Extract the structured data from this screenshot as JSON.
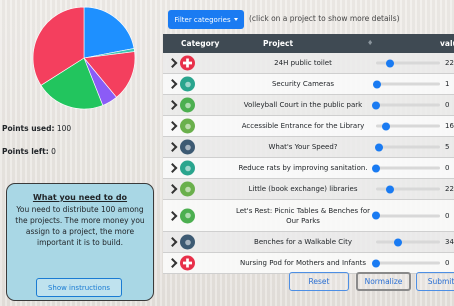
{
  "stats": {
    "points_used_label": "Points used:",
    "points_used_value": "100",
    "points_left_label": "Points left:",
    "points_left_value": "0"
  },
  "info": {
    "title": "What you need to do",
    "text": "You need to distribute 100 among the projects. The more money you assign to a project, the more important it is to build.",
    "button": "Show instructions"
  },
  "toolbar": {
    "filter_label": "Filter categories",
    "hint": "(click on a project to show more details)"
  },
  "table": {
    "headers": {
      "category": "Category",
      "project": "Project",
      "sort": "♦",
      "value": "valu"
    },
    "rows": [
      {
        "category_icon": "health-cross-icon",
        "icon_color": "#e8304a",
        "project": "24H public toilet",
        "value": "22",
        "level": 0.22
      },
      {
        "category_icon": "camera-icon",
        "icon_color": "#2aa58e",
        "project": "Security Cameras",
        "value": "1",
        "level": 0.01
      },
      {
        "category_icon": "park-icon",
        "icon_color": "#4caf50",
        "project": "Volleyball Court in the public park",
        "value": "0",
        "level": 0.0
      },
      {
        "category_icon": "culture-icon",
        "icon_color": "#6ab04c",
        "project": "Accessible Entrance for the Library",
        "value": "16",
        "level": 0.16
      },
      {
        "category_icon": "road-icon",
        "icon_color": "#3d5a73",
        "project": "What's Your Speed?",
        "value": "5",
        "level": 0.05
      },
      {
        "category_icon": "environment-icon",
        "icon_color": "#2aa58e",
        "project": "Reduce rats by improving sanitation.",
        "value": "0",
        "level": 0.0
      },
      {
        "category_icon": "culture-icon",
        "icon_color": "#6ab04c",
        "project": "Little (book exchange) libraries",
        "value": "22",
        "level": 0.22
      },
      {
        "category_icon": "park-icon",
        "icon_color": "#4caf50",
        "project": "Let's Rest: Picnic Tables & Benches for Our Parks",
        "value": "0",
        "level": 0.0
      },
      {
        "category_icon": "road-icon",
        "icon_color": "#3d5a73",
        "project": "Benches for a Walkable City",
        "value": "34",
        "level": 0.34
      },
      {
        "category_icon": "health-cross-icon",
        "icon_color": "#e8304a",
        "project": "Nursing Pod for Mothers and Infants",
        "value": "0",
        "level": 0.0
      }
    ]
  },
  "buttons": {
    "reset": "Reset",
    "normalize": "Normalize",
    "submit": "Submit"
  },
  "pie_slices": [
    {
      "value": 22,
      "color": "#1e90ff"
    },
    {
      "value": 1,
      "color": "#3cc8b4"
    },
    {
      "value": 16,
      "color": "#f43f5e"
    },
    {
      "value": 5,
      "color": "#8b5cf6"
    },
    {
      "value": 22,
      "color": "#22c55e"
    },
    {
      "value": 34,
      "color": "#f43f5e"
    }
  ]
}
